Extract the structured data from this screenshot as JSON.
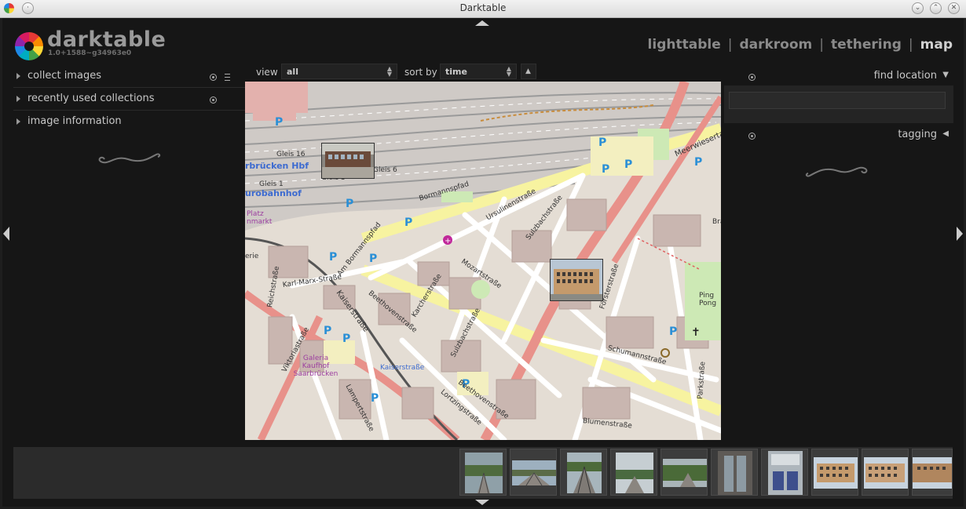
{
  "window": {
    "title": "Darktable"
  },
  "logo": {
    "name": "darktable",
    "version": "1.0+1588~g34963e0"
  },
  "views": {
    "lighttable": "lighttable",
    "darkroom": "darkroom",
    "tethering": "tethering",
    "map": "map",
    "separator": "|",
    "active": "map"
  },
  "left_panel": {
    "items": [
      {
        "label": "collect images"
      },
      {
        "label": "recently used collections"
      },
      {
        "label": "image information"
      }
    ]
  },
  "toolbar": {
    "view_label": "view",
    "view_value": "all",
    "sort_label": "sort by",
    "sort_value": "time"
  },
  "right_panel": {
    "find_location": "find location",
    "tagging": "tagging"
  },
  "map": {
    "streets": [
      "Gleis 16",
      "Gleis 3",
      "Gleis 6",
      "Gleis 1",
      "rbrücken Hbf",
      "urobahnhof",
      "Bormannspfad",
      "Ursulinenstraße",
      "Sulzbachstraße",
      "Meerwiesertal",
      "Am Bormannspfad",
      "Mozartstraße",
      "Kaiserstraße",
      "Karl-Marx-Straße",
      "Reichstraße",
      "Beethovenstraße",
      "Karcherstraße",
      "Viktoriastraße",
      "Galeria Kaufhof Saarbrücken",
      "Kaiserstraße",
      "Lampertstraße",
      "Lortzingstraße",
      "Schumannstraße",
      "Försterstraße",
      "Ping Pong",
      "Parkstraße",
      "Blumenstraße",
      "Sulzbachstraße",
      "Beethovenstraße",
      "Platz",
      "nmarkt",
      "erie",
      "Bra"
    ]
  },
  "colors": {
    "background": "#161616",
    "panel": "#2b2b2b",
    "text": "#c8c8c8",
    "accent_road": "#e8918a",
    "yellow_road": "#f7f3a0",
    "park": "#cde9b5"
  },
  "icons": {
    "reset": "reset-icon",
    "presets": "presets-icon",
    "expand": "triangle-right-icon",
    "collapse": "triangle-down-icon",
    "panel_left": "arrow-left-icon",
    "panel_right": "arrow-right-icon"
  }
}
